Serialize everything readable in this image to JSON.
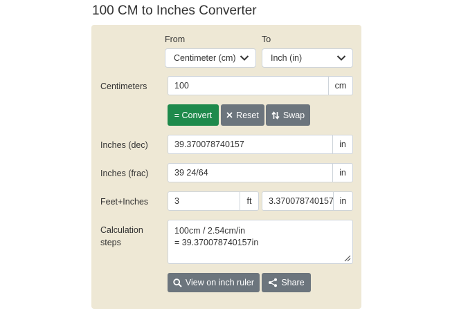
{
  "page": {
    "title": "100 CM to Inches Converter"
  },
  "from": {
    "label": "From",
    "selected": "Centimeter (cm)"
  },
  "to": {
    "label": "To",
    "selected": "Inch (in)"
  },
  "centimeters": {
    "label": "Centimeters",
    "value": "100",
    "unit": "cm"
  },
  "buttons": {
    "convert": "= Convert",
    "reset": "Reset",
    "swap": "Swap"
  },
  "inches_dec": {
    "label": "Inches (dec)",
    "value": "39.370078740157",
    "unit": "in"
  },
  "inches_frac": {
    "label": "Inches (frac)",
    "value": "39 24/64",
    "unit": "in"
  },
  "feet_inches": {
    "label": "Feet+Inches",
    "feet_value": "3",
    "feet_unit": "ft",
    "inches_value": "3.370078740157",
    "inches_unit": "in"
  },
  "steps": {
    "label_line1": "Calculation",
    "label_line2": "steps",
    "text": "100cm / 2.54cm/in\n= 39.370078740157in"
  },
  "actions": {
    "ruler": "View on inch ruler",
    "share": "Share"
  },
  "colors": {
    "panel": "#eee8d5",
    "convert": "#1e8a4c",
    "secondary": "#6c757d"
  }
}
